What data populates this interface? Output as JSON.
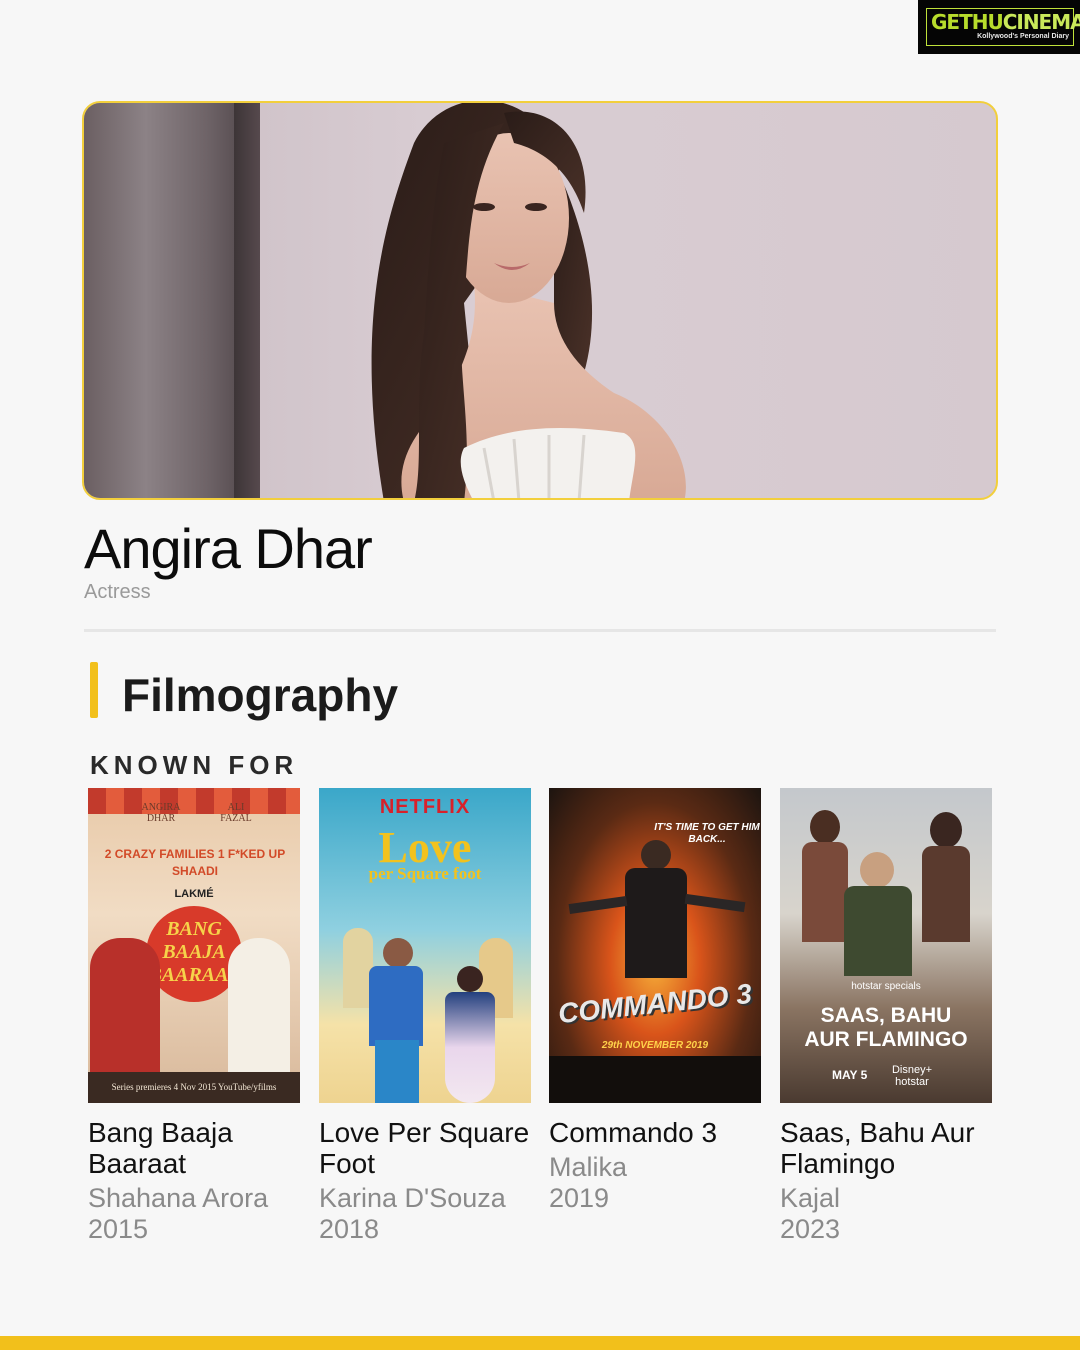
{
  "watermark": {
    "brand_a": "GETHU",
    "brand_b": "CINEMA",
    "tagline": "Kollywood's Personal Diary"
  },
  "person": {
    "name": "Angira Dhar",
    "role": "Actress"
  },
  "section": {
    "title": "Filmography",
    "subtitle": "KNOWN FOR"
  },
  "films": [
    {
      "title": "Bang Baaja Baaraat",
      "character": "Shahana Arora",
      "year": "2015",
      "poster": {
        "top_names": [
          "ANGIRA DHAR",
          "ALI FAZAL"
        ],
        "tagline": "2 CRAZY FAMILIES 1 F*KED UP SHAADI",
        "brand": "LAKMÉ",
        "logo": "BANG BAAJA BAARAAT",
        "footer": "Series premieres 4 Nov 2015 YouTube/yfilms"
      }
    },
    {
      "title": "Love Per Square Foot",
      "character": "Karina D'Souza",
      "year": "2018",
      "poster": {
        "brand": "NETFLIX",
        "logo_a": "Love",
        "logo_b": "per Square foot"
      }
    },
    {
      "title": "Commando 3",
      "character": "Malika",
      "year": "2019",
      "poster": {
        "tagline": "IT'S TIME TO GET HIM BACK...",
        "logo": "COMMANDO 3",
        "date": "29th NOVEMBER 2019"
      }
    },
    {
      "title": "Saas, Bahu Aur Flamingo",
      "character": "Kajal",
      "year": "2023",
      "poster": {
        "badge": "hotstar specials",
        "logo_a": "SAAS, BAHU",
        "logo_b": "AUR FLAMINGO",
        "date": "MAY 5",
        "platform": "Disney+ hotstar"
      }
    }
  ],
  "colors": {
    "accent": "#f2c01b",
    "hero_border": "#f2cf3c",
    "muted_text": "#8a8a8a"
  }
}
